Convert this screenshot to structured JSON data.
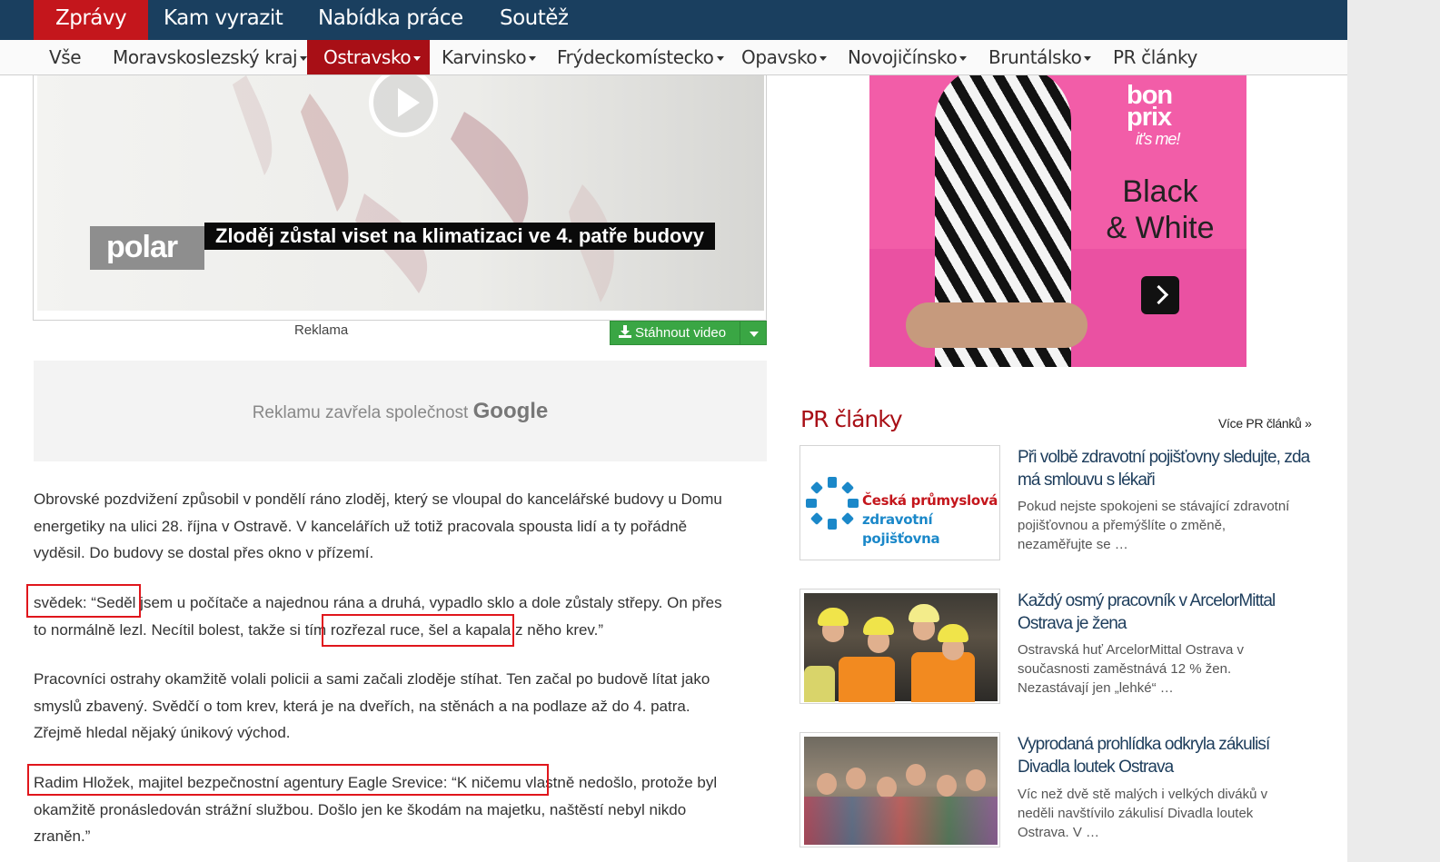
{
  "top_nav": {
    "items": [
      "Zprávy",
      "Kam vyrazit",
      "Nabídka práce",
      "Soutěž"
    ],
    "active_index": 0
  },
  "sub_nav": {
    "items": [
      {
        "label": "Vše",
        "dropdown": false
      },
      {
        "label": "Moravskoslezský kraj",
        "dropdown": true
      },
      {
        "label": "Ostravsko",
        "dropdown": true,
        "active": true
      },
      {
        "label": "Karvinsko",
        "dropdown": true
      },
      {
        "label": "Frýdeckomístecko",
        "dropdown": true
      },
      {
        "label": "Opavsko",
        "dropdown": true
      },
      {
        "label": "Novojičínsko",
        "dropdown": true
      },
      {
        "label": "Bruntálsko",
        "dropdown": true
      },
      {
        "label": "PR články",
        "dropdown": false
      }
    ]
  },
  "video": {
    "channel_logo": "polar",
    "caption": "Zloděj zůstal viset na klimatizaci ve 4. patře budovy",
    "ad_label": "Reklama",
    "download_label": "Stáhnout video",
    "play_icon": "play-icon",
    "download_icon": "download-icon"
  },
  "closed_ad": {
    "text": "Reklamu zavřela společnost",
    "brand": "Google"
  },
  "article": {
    "paragraphs": [
      "Obrovské pozdvižení způsobil v pondělí ráno zloděj, který se vloupal do kancelářské budovy u Domu energetiky na ulici 28. října v Ostravě. V kancelářích už totiž pracovala spousta lidí a ty pořádně vyděsil. Do budovy se dostal přes okno v přízemí.",
      "svědek: “Seděl jsem u počítače a najednou rána a druhá, vypadlo sklo a dole zůstaly střepy. On přes to normálně lezl. Necítil bolest, takže si tím rozřezal ruce, šel a kapala z něho krev.”",
      "Pracovníci ostrahy okamžitě volali policii a sami začali zloděje stíhat. Ten začal po budově lítat jako smyslů zbavený. Svědčí o tom krev, která je na dveřích, na stěnách a na podlaze až do 4. patra. Zřejmě hledal nějaký únikový východ.",
      "Radim Hložek, majitel bezpečnostní agentury Eagle Srevice: “K ničemu vlastně nedošlo, protože byl okamžitě pronásledován strážní službou. Došlo jen ke škodám na majetku, naštěstí nebyl nikdo zraněn.”"
    ],
    "highlight_color": "#e0161c"
  },
  "right_ad": {
    "brand_line1": "bon",
    "brand_line2": "prix",
    "brand_tagline": "it's me!",
    "headline_line1": "Black",
    "headline_line2": "& White",
    "arrow_icon": "chevron-right-icon"
  },
  "pr_articles": {
    "heading": "PR články",
    "more_label": "Více PR článků",
    "more_icon": "double-chevron-right-icon",
    "items": [
      {
        "title": "Při volbě zdravotní pojišťovny sledujte, zda má smlouvu s lékaři",
        "description": "Pokud nejste spokojeni se stávající zdravotní pojišťovnou a přemýšlíte o změně, nezaměřujte se …",
        "thumb_line1": "Česká průmyslová",
        "thumb_line2": "zdravotní pojišťovna"
      },
      {
        "title": "Každý osmý pracovník v ArcelorMittal Ostrava je žena",
        "description": "Ostravská huť ArcelorMittal Ostrava v současnosti zaměstnává 12 % žen. Nezastávají jen „lehké“ …"
      },
      {
        "title": "Vyprodaná prohlídka odkryla zákulisí Divadla loutek Ostrava",
        "description": "Víc než dvě stě malých i velkých diváků v neděli navštívilo zákulisí Divadla loutek Ostrava. V …"
      }
    ]
  },
  "colors": {
    "top_nav_bg": "#1a3f5f",
    "accent_red": "#c4161c",
    "download_green": "#3aa644",
    "pr_title_blue": "#1d3d5c"
  }
}
